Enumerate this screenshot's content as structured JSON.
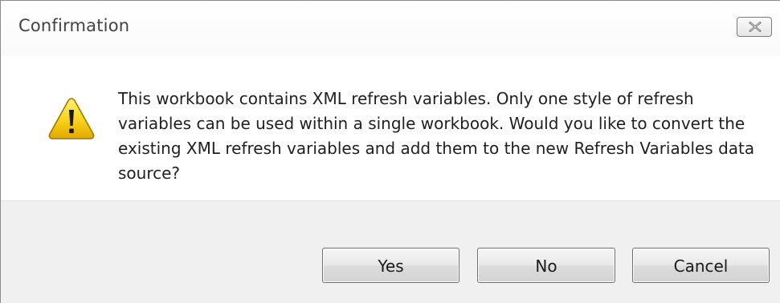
{
  "dialog": {
    "title": "Confirmation",
    "close_icon": "close-icon",
    "icon": "warning-icon",
    "message": "This workbook contains XML refresh variables. Only one style of refresh variables can be used within a single workbook. Would you like to convert the existing XML refresh variables and add them to the new Refresh Variables data source?",
    "buttons": {
      "yes": "Yes",
      "no": "No",
      "cancel": "Cancel"
    }
  },
  "colors": {
    "warning_fill": "#f5c800",
    "warning_border": "#a07800",
    "footer_bg": "#f0f0f0"
  }
}
